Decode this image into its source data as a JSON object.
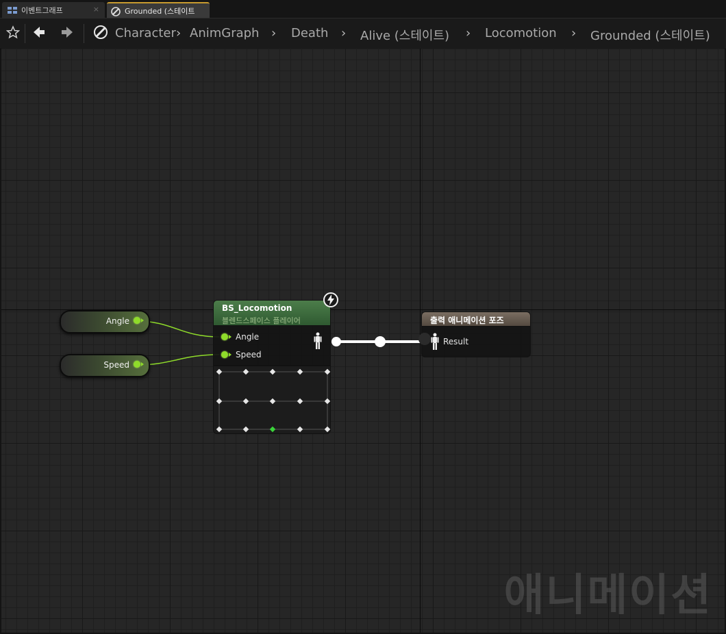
{
  "tabs": [
    {
      "label": "이벤트그래프",
      "icon": "event-graph-icon"
    },
    {
      "label": "Grounded (스테이트",
      "icon": "state-icon"
    }
  ],
  "toolbar": {
    "icons": [
      "star-icon",
      "back-arrow-icon",
      "forward-arrow-icon",
      "state-icon"
    ]
  },
  "breadcrumbs": [
    "Character",
    "AnimGraph",
    "Death",
    "Alive (스테이트)",
    "Locomotion",
    "Grounded (스테이트)"
  ],
  "graph": {
    "watermark": "애니메이션",
    "variables": [
      {
        "label": "Angle"
      },
      {
        "label": "Speed"
      }
    ],
    "blendspace_node": {
      "title": "BS_Locomotion",
      "subtitle": "블렌드스페이스 플레이어",
      "inputs": [
        "Angle",
        "Speed"
      ],
      "output_icon": "pose-icon",
      "badge_icon": "lightning-icon"
    },
    "output_node": {
      "title": "출력 애니메이션 포즈",
      "input": "Result",
      "input_icon": "pose-icon"
    }
  },
  "colors": {
    "float_pin": "#8fdc2a",
    "blendspace_header": "#4c7d4a",
    "output_header": "#7b6e62",
    "active_tab_accent": "#c89b2f"
  }
}
